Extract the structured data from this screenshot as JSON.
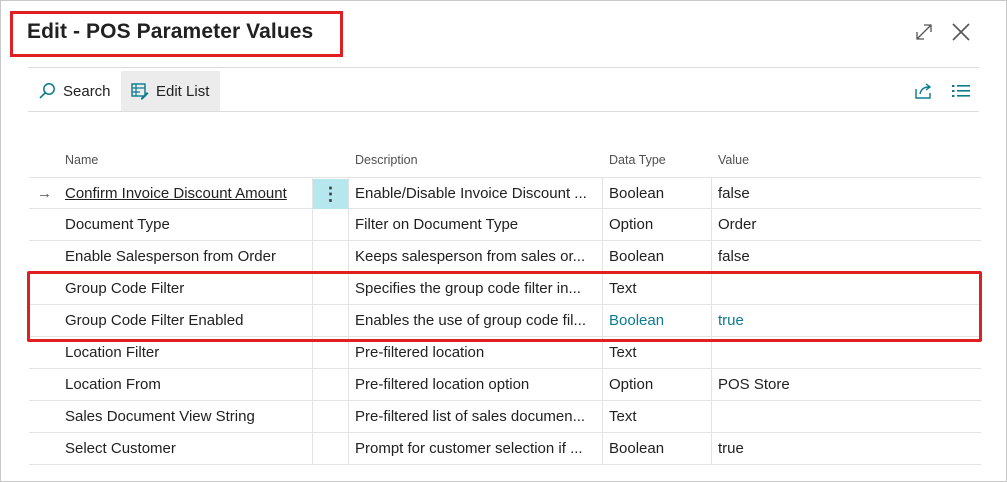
{
  "dialog": {
    "title": "Edit - POS Parameter Values",
    "expand_icon": "expand-icon",
    "close_icon": "close-icon"
  },
  "toolbar": {
    "search_label": "Search",
    "search_icon": "search-icon",
    "edit_list_label": "Edit List",
    "edit_list_icon": "edit-list-icon",
    "share_icon": "share-icon",
    "list_view_icon": "list-view-icon"
  },
  "table": {
    "headers": {
      "name": "Name",
      "description": "Description",
      "data_type": "Data Type",
      "value": "Value"
    },
    "rows": [
      {
        "name": "Confirm Invoice Discount Amount",
        "description": "Enable/Disable Invoice Discount ...",
        "data_type": "Boolean",
        "value": "false"
      },
      {
        "name": "Document Type",
        "description": "Filter on Document Type",
        "data_type": "Option",
        "value": "Order"
      },
      {
        "name": "Enable Salesperson from Order",
        "description": "Keeps salesperson from sales or...",
        "data_type": "Boolean",
        "value": "false"
      },
      {
        "name": "Group Code Filter",
        "description": "Specifies the group code filter in...",
        "data_type": "Text",
        "value": ""
      },
      {
        "name": "Group Code Filter Enabled",
        "description": "Enables the use of group code fil...",
        "data_type": "Boolean",
        "value": "true"
      },
      {
        "name": "Location Filter",
        "description": "Pre-filtered location",
        "data_type": "Text",
        "value": ""
      },
      {
        "name": "Location From",
        "description": "Pre-filtered location option",
        "data_type": "Option",
        "value": "POS Store"
      },
      {
        "name": "Sales Document View String",
        "description": "Pre-filtered list of sales documen...",
        "data_type": "Text",
        "value": ""
      },
      {
        "name": "Select Customer",
        "description": "Prompt for customer selection if ...",
        "data_type": "Boolean",
        "value": "true"
      }
    ],
    "row_actions_glyph": "⋮",
    "current_row_glyph": "→"
  },
  "colors": {
    "highlight_border": "#e02020",
    "accent_teal": "#0b7b8f",
    "active_cell": "#b6e6ee"
  }
}
